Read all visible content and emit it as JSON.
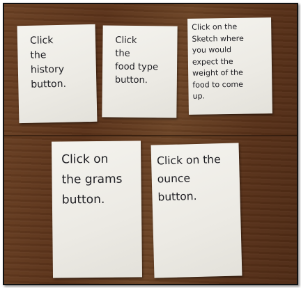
{
  "cards": [
    {
      "text": "Click\nthe\nhistory\nbutton."
    },
    {
      "text": "Click\nthe\nfood type\nbutton."
    },
    {
      "text": "Click on the\nSketch where\nyou would\nexpect the\nweight of the\nfood to come\nup."
    },
    {
      "text": "Click on\nthe grams\nbutton."
    },
    {
      "text": "Click on the\nounce\nbutton."
    }
  ],
  "colors": {
    "table_wood": "#5e371c",
    "card_paper": "#f1f0ea",
    "ink": "#1d1d22",
    "frame_border": "#111111"
  }
}
